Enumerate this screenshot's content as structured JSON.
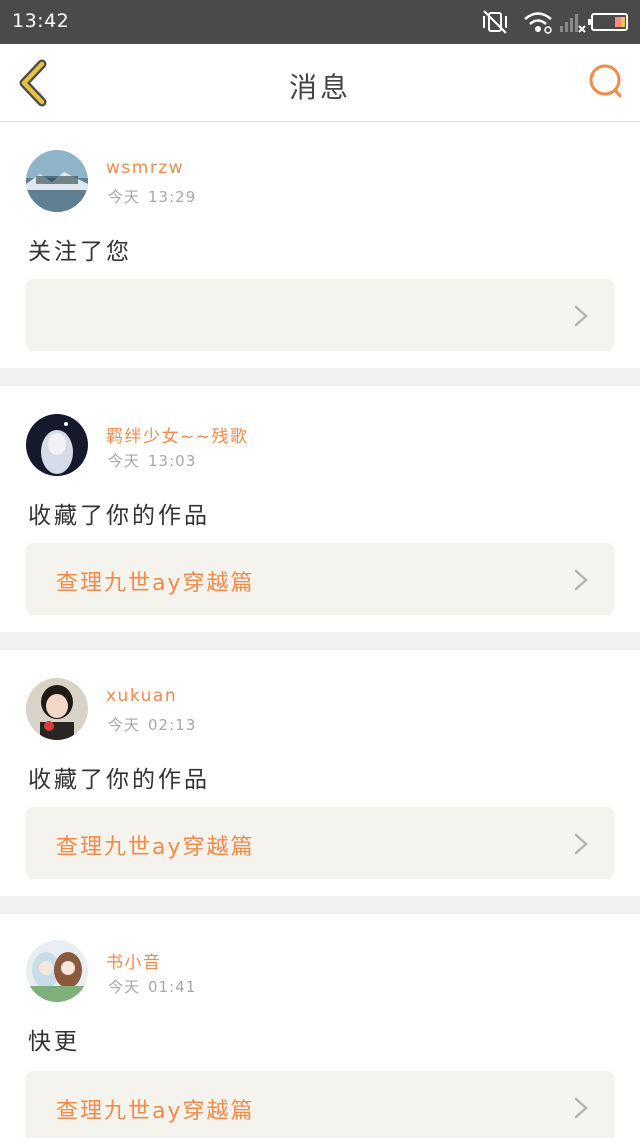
{
  "status_bar": {
    "time": "13:42",
    "icons": [
      "vibrate-off-icon",
      "wifi-icon",
      "signal-icon",
      "battery-icon"
    ]
  },
  "header": {
    "title": "消息",
    "back_icon": "chevron-left-icon",
    "search_icon": "search-icon"
  },
  "colors": {
    "accent": "#f28a4a",
    "back_icon": "#c7a322",
    "divider": "#f1f1ef",
    "work_box_bg": "#f4f3ee"
  },
  "messages": [
    {
      "username": "wsmrzw",
      "date": "今天",
      "time": "13:29",
      "action": "关注了您",
      "work_title": ""
    },
    {
      "username": "羁绊少女~~残歌",
      "date": "今天",
      "time": "13:03",
      "action": "收藏了你的作品",
      "work_title": "查理九世ay穿越篇"
    },
    {
      "username": "xukuan",
      "date": "今天",
      "time": "02:13",
      "action": "收藏了你的作品",
      "work_title": "查理九世ay穿越篇"
    },
    {
      "username": "书小音",
      "date": "今天",
      "time": "01:41",
      "action": "快更",
      "work_title": "查理九世ay穿越篇"
    }
  ]
}
